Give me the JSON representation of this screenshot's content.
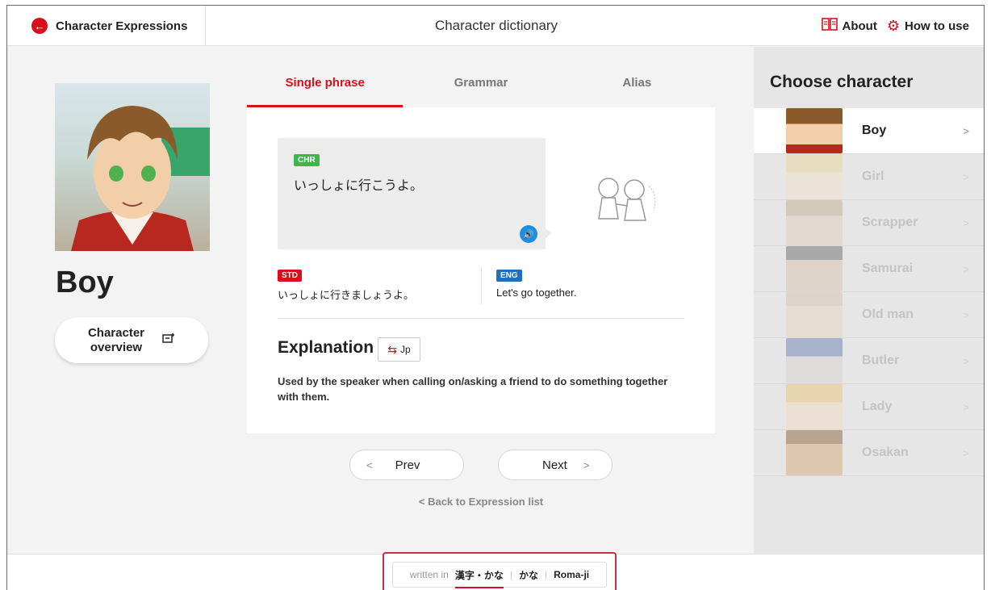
{
  "header": {
    "brand": "Character Expressions",
    "title": "Character dictionary",
    "about": "About",
    "how_to_use": "How to use"
  },
  "character": {
    "name": "Boy",
    "overview_line1": "Character",
    "overview_line2": "overview"
  },
  "tabs": [
    {
      "label": "Single phrase",
      "active": true
    },
    {
      "label": "Grammar",
      "active": false
    },
    {
      "label": "Alias",
      "active": false
    }
  ],
  "phrase": {
    "chr_badge": "CHR",
    "chr_text": "いっしょに行こうよ。",
    "std_badge": "STD",
    "std_text": "いっしょに行きましょうよ。",
    "eng_badge": "ENG",
    "eng_text": "Let's go together."
  },
  "explanation": {
    "title": "Explanation",
    "toggle_label": "Jp",
    "text": "Used by the speaker when calling on/asking a friend to do something together with them."
  },
  "pager": {
    "prev": "Prev",
    "next": "Next",
    "back": "Back to Expression list"
  },
  "sidebar": {
    "title": "Choose character",
    "items": [
      {
        "label": "Boy",
        "active": true
      },
      {
        "label": "Girl",
        "active": false
      },
      {
        "label": "Scrapper",
        "active": false
      },
      {
        "label": "Samurai",
        "active": false
      },
      {
        "label": "Old man",
        "active": false
      },
      {
        "label": "Butler",
        "active": false
      },
      {
        "label": "Lady",
        "active": false
      },
      {
        "label": "Osakan",
        "active": false
      }
    ]
  },
  "script_switch": {
    "written_in": "written in",
    "options": [
      "漢字・かな",
      "かな",
      "Roma-ji"
    ],
    "selected": "漢字・かな"
  },
  "colors": {
    "accent": "#d7101c",
    "chr_badge": "#3fb649",
    "eng_badge": "#1f6fc0",
    "speaker": "#1e8fe0"
  }
}
